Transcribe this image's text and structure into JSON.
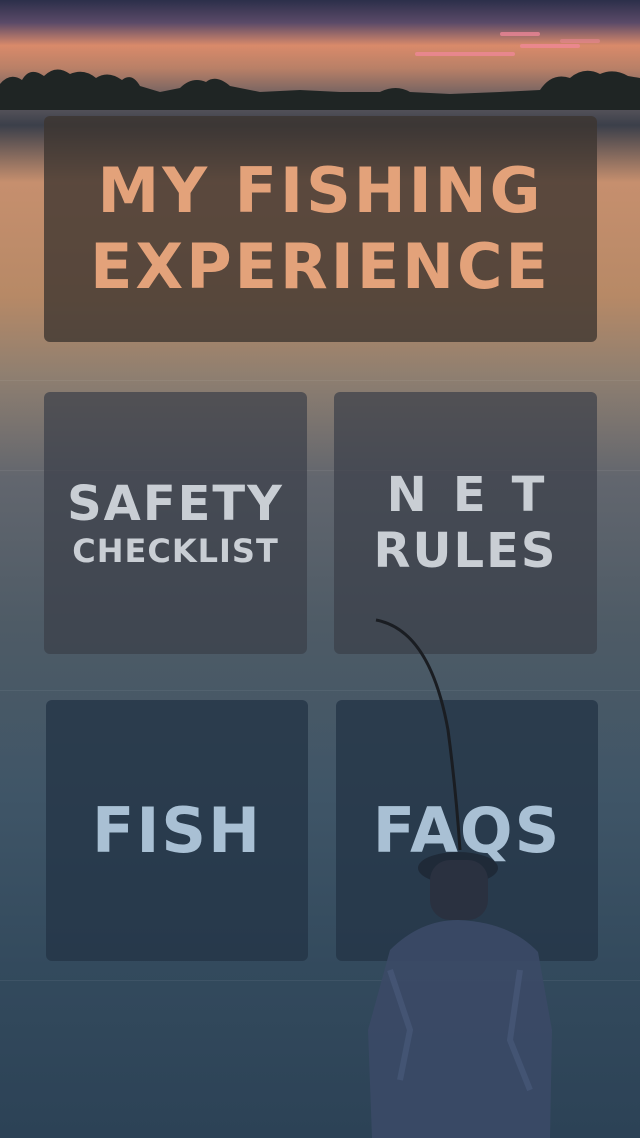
{
  "app": {
    "title_line1": "MY FISHING",
    "title_line2": "EXPERIENCE"
  },
  "menu": {
    "safety": {
      "line1": "SAFETY",
      "line2": "CHECKLIST"
    },
    "net": {
      "line1": "NET",
      "line2": "RULES"
    },
    "fish": {
      "label": "FISH"
    },
    "faqs": {
      "label": "FAQS"
    }
  },
  "colors": {
    "title_text": "#e3a27a",
    "menu_text": "#c9ced4"
  }
}
